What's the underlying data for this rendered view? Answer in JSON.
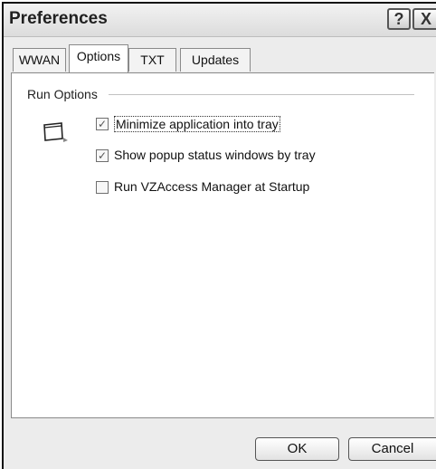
{
  "window": {
    "title": "Preferences"
  },
  "titlebar_buttons": {
    "help": "?",
    "close": "X"
  },
  "tabs": [
    {
      "label": "WWAN"
    },
    {
      "label": "Options"
    },
    {
      "label": "TXT"
    },
    {
      "label": "Updates"
    }
  ],
  "active_tab": "Options",
  "run_options": {
    "label": "Run Options",
    "icon": "tray-window-icon",
    "items": [
      {
        "label": "Minimize application into tray",
        "checked": true
      },
      {
        "label": "Show popup status windows by tray",
        "checked": true
      },
      {
        "label": "Run VZAccess Manager at Startup",
        "checked": false
      }
    ]
  },
  "buttons": {
    "ok": "OK",
    "cancel": "Cancel"
  }
}
